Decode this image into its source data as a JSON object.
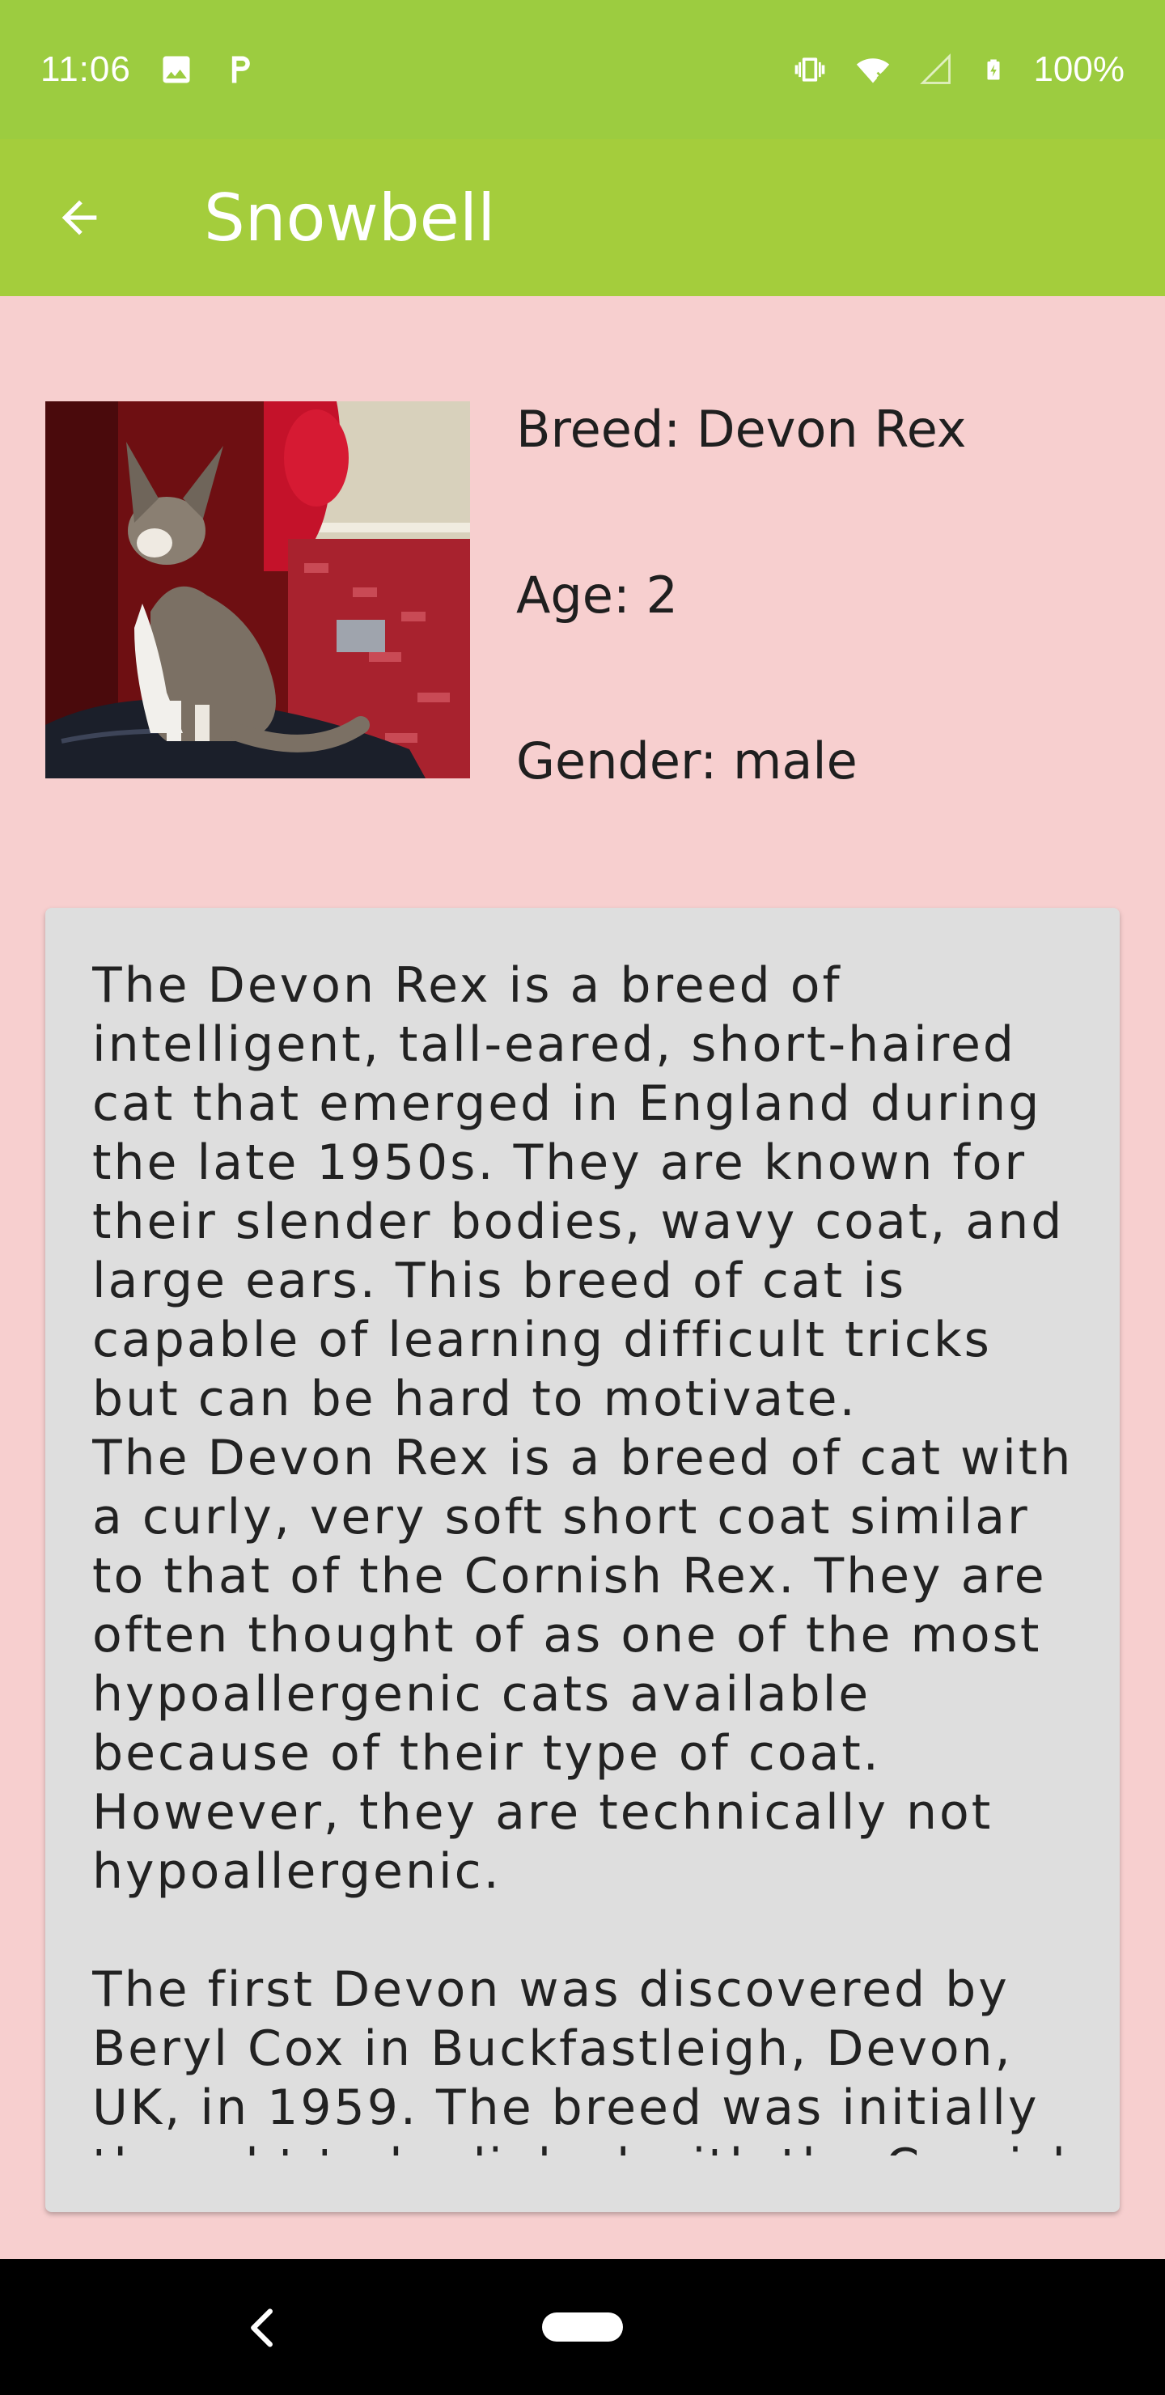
{
  "status_bar": {
    "time": "11:06",
    "battery_pct": "100%",
    "icons_left": [
      "image-icon",
      "parking-icon"
    ],
    "icons_right": [
      "vibrate-icon",
      "wifi-icon",
      "signal-icon",
      "battery-icon"
    ]
  },
  "app_bar": {
    "title": "Snowbell",
    "back_icon": "arrow-left-icon"
  },
  "cat": {
    "breed": "Breed: Devon Rex",
    "age": "Age: 2",
    "gender": "Gender: male"
  },
  "description": "The Devon Rex is a breed of intelligent, tall-eared, short-haired cat that emerged in England during the late 1950s. They are known for their slender bodies, wavy coat, and large ears. This breed of cat is capable of learning difficult tricks but can be hard to motivate.\nThe Devon Rex is a breed of cat with a curly, very soft short coat similar to that of the Cornish Rex. They are often thought of as one of the most hypoallergenic cats available because of their type of coat. However, they are technically not hypoallergenic.\n\nThe first Devon was discovered by Beryl Cox in Buckfastleigh, Devon, UK, in 1959. The breed was initially thought to be linked with the Cornish",
  "colors": {
    "status_bar": "#9ccc40",
    "app_bar": "#a4cd3c",
    "background": "#f7cfcf",
    "card": "#dedede"
  }
}
